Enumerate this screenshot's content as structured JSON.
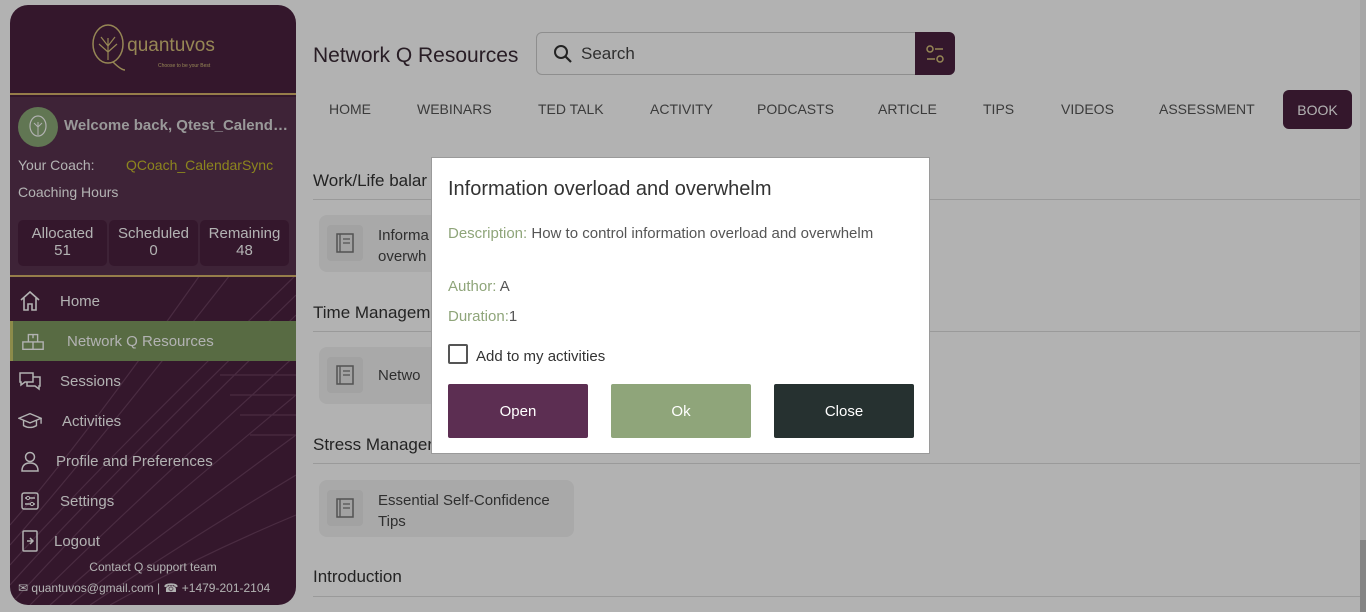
{
  "brand": {
    "name": "quantuvos",
    "tagline": "Choose to be your Best"
  },
  "profile": {
    "welcome": "Welcome back, Qtest_CalendarSync",
    "coach_label": "Your Coach:",
    "coach_name": "QCoach_CalendarSync",
    "hours_label": "Coaching Hours",
    "stats": [
      {
        "label": "Allocated",
        "value": "51"
      },
      {
        "label": "Scheduled",
        "value": "0"
      },
      {
        "label": "Remaining",
        "value": "48"
      }
    ]
  },
  "nav": [
    {
      "label": "Home",
      "icon": "home-icon"
    },
    {
      "label": "Network Q Resources",
      "icon": "resources-icon",
      "active": true
    },
    {
      "label": "Sessions",
      "icon": "chat-icon"
    },
    {
      "label": "Activities",
      "icon": "graduation-cap-icon"
    },
    {
      "label": "Profile and Preferences",
      "icon": "person-icon"
    },
    {
      "label": "Settings",
      "icon": "settings-icon"
    },
    {
      "label": "Logout",
      "icon": "logout-icon"
    }
  ],
  "contact": {
    "title": "Contact Q support team",
    "email": "quantuvos@gmail.com",
    "separator": "|",
    "phone": "+1479-201-2104"
  },
  "header": {
    "title": "Network Q Resources",
    "search_placeholder": "Search"
  },
  "tabs": [
    "HOME",
    "WEBINARS",
    "TED TALK",
    "ACTIVITY",
    "PODCASTS",
    "ARTICLE",
    "TIPS",
    "VIDEOS",
    "ASSESSMENT",
    "BOOK"
  ],
  "sections": [
    {
      "title": "Work/Life balar",
      "cards": [
        {
          "title": "Informa",
          "title2": "overwh"
        }
      ]
    },
    {
      "title": "Time Managem",
      "cards": [
        {
          "title": "Netwo"
        }
      ]
    },
    {
      "title": "Stress Manager",
      "cards": [
        {
          "title": "Essential Self-Confidence",
          "title2": "Tips"
        }
      ]
    },
    {
      "title": "Introduction",
      "cards": []
    }
  ],
  "modal": {
    "title": "Information overload and overwhelm",
    "description_label": "Description:",
    "description": "How to control information overload and overwhelm",
    "author_label": "Author:",
    "author": "A",
    "duration_label": "Duration:",
    "duration": "1",
    "checkbox_label": "Add to my activities",
    "checked": false,
    "buttons": {
      "open": "Open",
      "ok": "Ok",
      "close": "Close"
    }
  },
  "colors": {
    "sidebar_bg": "#4b2140",
    "accent_green": "#8fa57a",
    "gold": "#d7c27a",
    "close_btn": "#263130"
  }
}
